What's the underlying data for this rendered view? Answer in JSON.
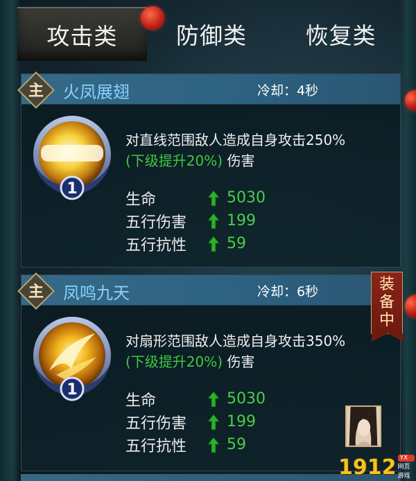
{
  "tabs": [
    {
      "label": "攻击类",
      "active": true
    },
    {
      "label": "防御类",
      "active": false
    },
    {
      "label": "恢复类",
      "active": false
    }
  ],
  "skills": [
    {
      "badge": "主",
      "name": "火凤展翅",
      "cooldown": "冷却：4秒",
      "level": "1",
      "desc_line1": "对直线范围敌人造成自身攻击250%",
      "desc_upgrade": "(下级提升20%)",
      "desc_suffix": "伤害",
      "stats": [
        {
          "label": "生命",
          "value": "5030"
        },
        {
          "label": "五行伤害",
          "value": "199"
        },
        {
          "label": "五行抗性",
          "value": "59"
        }
      ]
    },
    {
      "badge": "主",
      "name": "凤鸣九天",
      "cooldown": "冷却：6秒",
      "level": "1",
      "desc_line1": "对扇形范围敌人造成自身攻击350%",
      "desc_upgrade": "(下级提升20%)",
      "desc_suffix": "伤害",
      "stats": [
        {
          "label": "生命",
          "value": "5030"
        },
        {
          "label": "五行伤害",
          "value": "199"
        },
        {
          "label": "五行抗性",
          "value": "59"
        }
      ]
    }
  ],
  "equip_tag": [
    "装",
    "备",
    "中"
  ],
  "watermark": {
    "number": "1912",
    "badge": "YX",
    "sub": "网页游戏"
  },
  "colors": {
    "skill_name": "#8ad0ff",
    "stat_value": "#46d046",
    "upgrade": "#40c840",
    "header_bar": "#356a87"
  }
}
